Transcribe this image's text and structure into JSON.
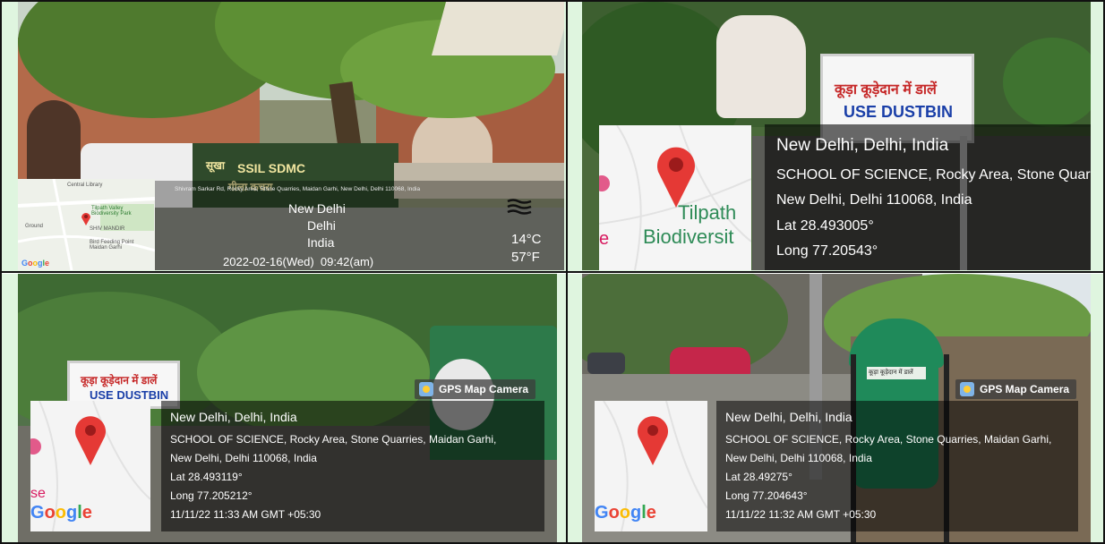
{
  "panel1": {
    "address_line1": "New Delhi",
    "address_line2": "Delhi",
    "address_line3": "India",
    "temp_c": "14°C",
    "temp_f": "57°F",
    "datetime": "2022-02-16(Wed)  09:42(am)",
    "map_address": "Shivram Sarkar Rd, Rocky Area, Stone Quarries, Maidan Garhi, New Delhi, Delhi 110068, India",
    "truck_text_1": "SSIL SDMC",
    "truck_text_2": "सूखा",
    "truck_text_3": "गीला कचरा",
    "map_labels": [
      "Central Library",
      "Tilpath Valley Biodiversity Park",
      "SHIV MANDIR",
      "Bird Feeding Point Maidan Garhi",
      "Ground"
    ],
    "google_label": "Google"
  },
  "panel2": {
    "title": "New Delhi, Delhi, India",
    "address_1": "SCHOOL OF SCIENCE, Rocky Area, Stone Quar",
    "address_2": "New Delhi, Delhi 110068, India",
    "lat": "Lat 28.493005°",
    "long": "Long 77.20543°",
    "sign_hindi": "कूड़ा कूड़ेदान में डालें",
    "sign_english": "USE DUSTBIN",
    "map_label_1": "Tilpath",
    "map_label_2": "Biodiversit",
    "map_label_e": "e"
  },
  "panel3": {
    "badge": "GPS Map Camera",
    "title": "New Delhi, Delhi, India",
    "address_1": "SCHOOL OF SCIENCE, Rocky Area, Stone Quarries, Maidan Garhi,",
    "address_2": "New Delhi, Delhi 110068, India",
    "lat": "Lat 28.493119°",
    "long": "Long 77.205212°",
    "datetime": "11/11/22 11:33 AM GMT +05:30",
    "sign_hindi": "कूड़ा कूड़ेदान में डालें",
    "sign_english": "USE DUSTBIN",
    "map_label": "se",
    "google_label": "Google"
  },
  "panel4": {
    "badge": "GPS Map Camera",
    "title": "New Delhi, Delhi, India",
    "address_1": "SCHOOL OF SCIENCE, Rocky Area, Stone Quarries, Maidan Garhi,",
    "address_2": "New Delhi, Delhi 110068, India",
    "lat": "Lat 28.49275°",
    "long": "Long 77.204643°",
    "datetime": "11/11/22 11:32 AM GMT +05:30",
    "bin_label": "कूड़ा कूड़ेदान में डालें",
    "google_label": "Google"
  },
  "colors": {
    "pin_red": "#e53935",
    "google_blue": "#4285F4",
    "google_red": "#EA4335",
    "google_yellow": "#FBBC05",
    "google_green": "#34A853",
    "bin_green": "#1f8a5a"
  }
}
